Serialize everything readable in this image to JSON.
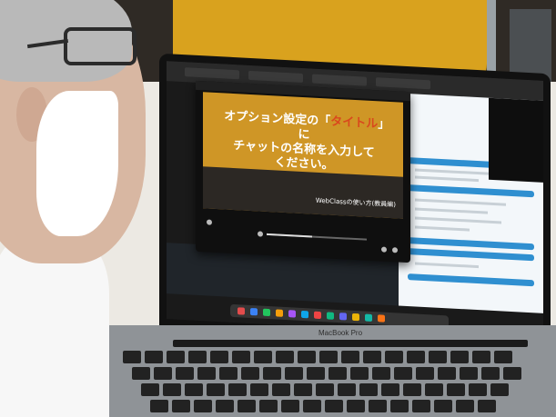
{
  "video": {
    "slide_text_line1_before": "オプション設定の「",
    "slide_text_highlight": "タイトル",
    "slide_text_line1_after": "」に",
    "slide_text_line2": "チャットの名称を入力して",
    "slide_text_line3": "ください。",
    "caption": "WebClassの使い方(教員編)",
    "progress": 0.45
  },
  "laptop": {
    "brand": "MacBook Pro"
  },
  "colors": {
    "slide_bg": "#cf9626",
    "highlight": "#d9481d",
    "accent_blue": "#2f8fd0"
  }
}
